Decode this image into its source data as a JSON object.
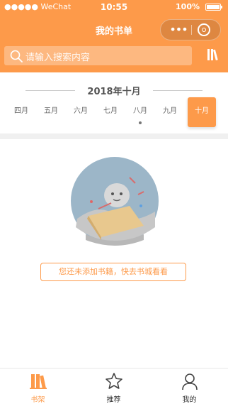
{
  "status_bar": {
    "carrier": "●●●●● WeChat",
    "time": "10:55",
    "battery": "100%"
  },
  "nav": {
    "title": "我的书单",
    "more": "•••"
  },
  "search": {
    "placeholder": "请输入搜索内容"
  },
  "calendar": {
    "title": "2018年十月",
    "months": [
      {
        "label": "四月"
      },
      {
        "label": "五月"
      },
      {
        "label": "六月"
      },
      {
        "label": "七月"
      },
      {
        "label": "八月",
        "has_dot": true
      },
      {
        "label": "九月"
      },
      {
        "label": "十月",
        "active": true
      }
    ]
  },
  "empty_state": {
    "button_label": "您还未添加书籍，快去书城看看"
  },
  "tabbar": {
    "items": [
      {
        "label": "书架",
        "icon": "books-icon",
        "active": true
      },
      {
        "label": "推荐",
        "icon": "star-icon"
      },
      {
        "label": "我的",
        "icon": "user-icon"
      }
    ]
  },
  "colors": {
    "accent": "#fd9a4a",
    "divider": "#f0f0f0"
  }
}
